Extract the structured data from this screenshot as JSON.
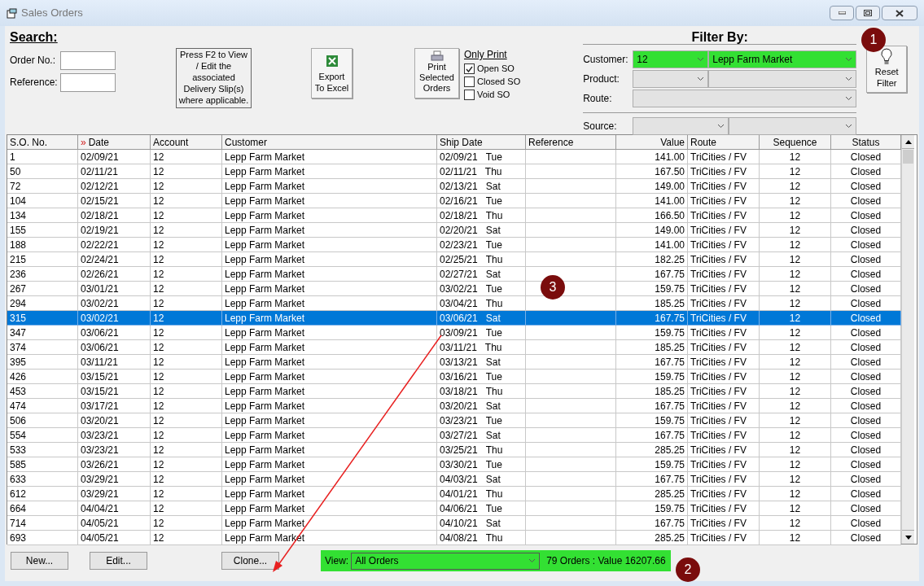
{
  "window": {
    "title": "Sales Orders"
  },
  "search": {
    "heading": "Search:",
    "fields": [
      {
        "label": "Order No.:"
      },
      {
        "label": "Reference:"
      }
    ]
  },
  "f2_note": "Press F2 to View / Edit the associated Delivery Slip(s) where applicable.",
  "export_button": {
    "lines": [
      "Export",
      "To Excel"
    ]
  },
  "print_button": {
    "lines": [
      "Print",
      "Selected",
      "Orders"
    ]
  },
  "only_print": {
    "heading": "Only Print",
    "options": [
      {
        "label": "Open SO",
        "checked": true
      },
      {
        "label": "Closed SO",
        "checked": false
      },
      {
        "label": "Void SO",
        "checked": false
      }
    ]
  },
  "filter": {
    "heading": "Filter By:",
    "rows": [
      {
        "label": "Customer:",
        "kind": "pair",
        "active": true,
        "values": [
          "12",
          "Lepp Farm Market"
        ]
      },
      {
        "label": "Product:",
        "kind": "pair",
        "active": false
      },
      {
        "label": "Route:",
        "kind": "single",
        "active": false
      },
      {
        "label": "Source:",
        "kind": "pair",
        "active": false
      }
    ]
  },
  "reset_button": {
    "lines": [
      "Reset",
      "Filter"
    ]
  },
  "table": {
    "columns": [
      {
        "label": "S.O. No."
      },
      {
        "label": "Date",
        "marker": "»"
      },
      {
        "label": "Account"
      },
      {
        "label": "Customer"
      },
      {
        "label": "Ship Date"
      },
      {
        "label": "Reference"
      },
      {
        "label": "Value"
      },
      {
        "label": "Route"
      },
      {
        "label": "Sequence"
      },
      {
        "label": "Status"
      }
    ],
    "rows": [
      {
        "so": "1",
        "date": "02/09/21",
        "account": "12",
        "customer": "Lepp Farm Market",
        "ship_date": "02/09/21",
        "ship_day": "Tue",
        "value": "141.00",
        "route": "TriCities / FV",
        "sequence": "12",
        "status": "Closed",
        "selected": false
      },
      {
        "so": "50",
        "date": "02/11/21",
        "account": "12",
        "customer": "Lepp Farm Market",
        "ship_date": "02/11/21",
        "ship_day": "Thu",
        "value": "167.50",
        "route": "TriCities / FV",
        "sequence": "12",
        "status": "Closed",
        "selected": false
      },
      {
        "so": "72",
        "date": "02/12/21",
        "account": "12",
        "customer": "Lepp Farm Market",
        "ship_date": "02/13/21",
        "ship_day": "Sat",
        "value": "149.00",
        "route": "TriCities / FV",
        "sequence": "12",
        "status": "Closed",
        "selected": false
      },
      {
        "so": "104",
        "date": "02/15/21",
        "account": "12",
        "customer": "Lepp Farm Market",
        "ship_date": "02/16/21",
        "ship_day": "Tue",
        "value": "141.00",
        "route": "TriCities / FV",
        "sequence": "12",
        "status": "Closed",
        "selected": false
      },
      {
        "so": "134",
        "date": "02/18/21",
        "account": "12",
        "customer": "Lepp Farm Market",
        "ship_date": "02/18/21",
        "ship_day": "Thu",
        "value": "166.50",
        "route": "TriCities / FV",
        "sequence": "12",
        "status": "Closed",
        "selected": false
      },
      {
        "so": "155",
        "date": "02/19/21",
        "account": "12",
        "customer": "Lepp Farm Market",
        "ship_date": "02/20/21",
        "ship_day": "Sat",
        "value": "149.00",
        "route": "TriCities / FV",
        "sequence": "12",
        "status": "Closed",
        "selected": false
      },
      {
        "so": "188",
        "date": "02/22/21",
        "account": "12",
        "customer": "Lepp Farm Market",
        "ship_date": "02/23/21",
        "ship_day": "Tue",
        "value": "141.00",
        "route": "TriCities / FV",
        "sequence": "12",
        "status": "Closed",
        "selected": false
      },
      {
        "so": "215",
        "date": "02/24/21",
        "account": "12",
        "customer": "Lepp Farm Market",
        "ship_date": "02/25/21",
        "ship_day": "Thu",
        "value": "182.25",
        "route": "TriCities / FV",
        "sequence": "12",
        "status": "Closed",
        "selected": false
      },
      {
        "so": "236",
        "date": "02/26/21",
        "account": "12",
        "customer": "Lepp Farm Market",
        "ship_date": "02/27/21",
        "ship_day": "Sat",
        "value": "167.75",
        "route": "TriCities / FV",
        "sequence": "12",
        "status": "Closed",
        "selected": false
      },
      {
        "so": "267",
        "date": "03/01/21",
        "account": "12",
        "customer": "Lepp Farm Market",
        "ship_date": "03/02/21",
        "ship_day": "Tue",
        "value": "159.75",
        "route": "TriCities / FV",
        "sequence": "12",
        "status": "Closed",
        "selected": false
      },
      {
        "so": "294",
        "date": "03/02/21",
        "account": "12",
        "customer": "Lepp Farm Market",
        "ship_date": "03/04/21",
        "ship_day": "Thu",
        "value": "185.25",
        "route": "TriCities / FV",
        "sequence": "12",
        "status": "Closed",
        "selected": false
      },
      {
        "so": "315",
        "date": "03/02/21",
        "account": "12",
        "customer": "Lepp Farm Market",
        "ship_date": "03/06/21",
        "ship_day": "Sat",
        "value": "167.75",
        "route": "TriCities / FV",
        "sequence": "12",
        "status": "Closed",
        "selected": true
      },
      {
        "so": "347",
        "date": "03/06/21",
        "account": "12",
        "customer": "Lepp Farm Market",
        "ship_date": "03/09/21",
        "ship_day": "Tue",
        "value": "159.75",
        "route": "TriCities / FV",
        "sequence": "12",
        "status": "Closed",
        "selected": false
      },
      {
        "so": "374",
        "date": "03/06/21",
        "account": "12",
        "customer": "Lepp Farm Market",
        "ship_date": "03/11/21",
        "ship_day": "Thu",
        "value": "185.25",
        "route": "TriCities / FV",
        "sequence": "12",
        "status": "Closed",
        "selected": false
      },
      {
        "so": "395",
        "date": "03/11/21",
        "account": "12",
        "customer": "Lepp Farm Market",
        "ship_date": "03/13/21",
        "ship_day": "Sat",
        "value": "167.75",
        "route": "TriCities / FV",
        "sequence": "12",
        "status": "Closed",
        "selected": false
      },
      {
        "so": "426",
        "date": "03/15/21",
        "account": "12",
        "customer": "Lepp Farm Market",
        "ship_date": "03/16/21",
        "ship_day": "Tue",
        "value": "159.75",
        "route": "TriCities / FV",
        "sequence": "12",
        "status": "Closed",
        "selected": false
      },
      {
        "so": "453",
        "date": "03/15/21",
        "account": "12",
        "customer": "Lepp Farm Market",
        "ship_date": "03/18/21",
        "ship_day": "Thu",
        "value": "185.25",
        "route": "TriCities / FV",
        "sequence": "12",
        "status": "Closed",
        "selected": false
      },
      {
        "so": "474",
        "date": "03/17/21",
        "account": "12",
        "customer": "Lepp Farm Market",
        "ship_date": "03/20/21",
        "ship_day": "Sat",
        "value": "167.75",
        "route": "TriCities / FV",
        "sequence": "12",
        "status": "Closed",
        "selected": false
      },
      {
        "so": "506",
        "date": "03/20/21",
        "account": "12",
        "customer": "Lepp Farm Market",
        "ship_date": "03/23/21",
        "ship_day": "Tue",
        "value": "159.75",
        "route": "TriCities / FV",
        "sequence": "12",
        "status": "Closed",
        "selected": false
      },
      {
        "so": "554",
        "date": "03/23/21",
        "account": "12",
        "customer": "Lepp Farm Market",
        "ship_date": "03/27/21",
        "ship_day": "Sat",
        "value": "167.75",
        "route": "TriCities / FV",
        "sequence": "12",
        "status": "Closed",
        "selected": false
      },
      {
        "so": "533",
        "date": "03/23/21",
        "account": "12",
        "customer": "Lepp Farm Market",
        "ship_date": "03/25/21",
        "ship_day": "Thu",
        "value": "285.25",
        "route": "TriCities / FV",
        "sequence": "12",
        "status": "Closed",
        "selected": false
      },
      {
        "so": "585",
        "date": "03/26/21",
        "account": "12",
        "customer": "Lepp Farm Market",
        "ship_date": "03/30/21",
        "ship_day": "Tue",
        "value": "159.75",
        "route": "TriCities / FV",
        "sequence": "12",
        "status": "Closed",
        "selected": false
      },
      {
        "so": "633",
        "date": "03/29/21",
        "account": "12",
        "customer": "Lepp Farm Market",
        "ship_date": "04/03/21",
        "ship_day": "Sat",
        "value": "167.75",
        "route": "TriCities / FV",
        "sequence": "12",
        "status": "Closed",
        "selected": false
      },
      {
        "so": "612",
        "date": "03/29/21",
        "account": "12",
        "customer": "Lepp Farm Market",
        "ship_date": "04/01/21",
        "ship_day": "Thu",
        "value": "285.25",
        "route": "TriCities / FV",
        "sequence": "12",
        "status": "Closed",
        "selected": false
      },
      {
        "so": "664",
        "date": "04/04/21",
        "account": "12",
        "customer": "Lepp Farm Market",
        "ship_date": "04/06/21",
        "ship_day": "Tue",
        "value": "159.75",
        "route": "TriCities / FV",
        "sequence": "12",
        "status": "Closed",
        "selected": false
      },
      {
        "so": "714",
        "date": "04/05/21",
        "account": "12",
        "customer": "Lepp Farm Market",
        "ship_date": "04/10/21",
        "ship_day": "Sat",
        "value": "167.75",
        "route": "TriCities / FV",
        "sequence": "12",
        "status": "Closed",
        "selected": false
      },
      {
        "so": "693",
        "date": "04/05/21",
        "account": "12",
        "customer": "Lepp Farm Market",
        "ship_date": "04/08/21",
        "ship_day": "Thu",
        "value": "285.25",
        "route": "TriCities / FV",
        "sequence": "12",
        "status": "Closed",
        "selected": false
      }
    ]
  },
  "buttons": [
    "New...",
    "Edit...",
    "Clone..."
  ],
  "view": {
    "label": "View:",
    "value": "All Orders",
    "active": true,
    "summary": "79 Orders : Value 16207.66"
  },
  "callouts": [
    "1",
    "2",
    "3"
  ]
}
